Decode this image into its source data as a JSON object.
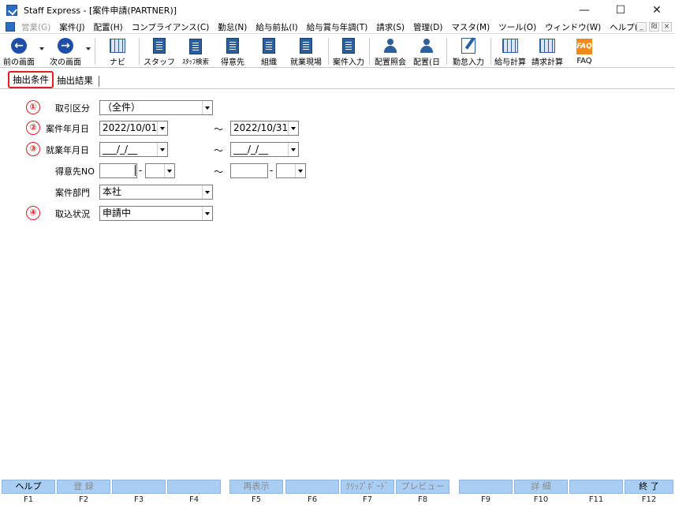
{
  "window": {
    "title": "Staff Express - [案件申請(PARTNER)]",
    "controls": [
      "—",
      "☐",
      "✕"
    ]
  },
  "menu": {
    "items": [
      {
        "label": "営業(G)",
        "disabled": true
      },
      {
        "label": "案件(J)"
      },
      {
        "label": "配置(H)"
      },
      {
        "label": "コンプライアンス(C)"
      },
      {
        "label": "勤怠(N)"
      },
      {
        "label": "給与前払(I)"
      },
      {
        "label": "給与賞与年調(T)"
      },
      {
        "label": "請求(S)"
      },
      {
        "label": "管理(D)"
      },
      {
        "label": "マスタ(M)"
      },
      {
        "label": "ツール(O)"
      },
      {
        "label": "ウィンドウ(W)"
      },
      {
        "label": "ヘルプ(H)"
      }
    ],
    "mdi_buttons": [
      "_",
      "₪",
      "×"
    ]
  },
  "toolbar": {
    "prev": "前の画面",
    "next": "次の画面",
    "navi": "ナビ",
    "staff": "スタッフ",
    "staff_search": "ｽﾀｯﾌ検索",
    "client": "得意先",
    "org": "組織",
    "site": "就業現場",
    "case_input": "案件入力",
    "assign_inquiry": "配置照会",
    "assign_day": "配置(日",
    "attendance_input": "勤怠入力",
    "payroll_calc": "給与計算",
    "billing_calc": "請求計算",
    "faq": "FAQ",
    "faq_icon_text": "FAQ"
  },
  "tabs": {
    "conditions": "抽出条件",
    "results": "抽出結果"
  },
  "form": {
    "row1": {
      "marker": "①",
      "label": "取引区分",
      "value": "（全件）"
    },
    "row2": {
      "marker": "②",
      "label": "案件年月日",
      "from": "2022/10/01",
      "tilde": "～",
      "to": "2022/10/31"
    },
    "row3": {
      "marker": "③",
      "label": "就業年月日",
      "from": "___/_/__",
      "tilde": "～",
      "to": "___/_/__"
    },
    "row4": {
      "label": "得意先NO",
      "from_main": "",
      "from_sub": "",
      "tilde": "～",
      "to_main": "",
      "to_sub": "",
      "dash": "-"
    },
    "row5": {
      "label": "案件部門",
      "value": "本社"
    },
    "row6": {
      "marker": "④",
      "label": "取込状況",
      "value": "申請中"
    }
  },
  "fkeys": [
    {
      "label": "ヘルプ",
      "key": "F1"
    },
    {
      "label": "登 録",
      "key": "F2",
      "dim": true
    },
    {
      "label": "",
      "key": "F3"
    },
    {
      "label": "",
      "key": "F4"
    },
    {
      "label": "再表示",
      "key": "F5",
      "dim": true
    },
    {
      "label": "",
      "key": "F6"
    },
    {
      "label": "ｸﾘｯﾌﾟﾎﾞｰﾄﾞ",
      "key": "F7",
      "dim": true
    },
    {
      "label": "プレビュー",
      "key": "F8",
      "dim": true
    },
    {
      "label": "",
      "key": "F9"
    },
    {
      "label": "詳 細",
      "key": "F10",
      "dim": true
    },
    {
      "label": "",
      "key": "F11"
    },
    {
      "label": "終 了",
      "key": "F12"
    }
  ]
}
